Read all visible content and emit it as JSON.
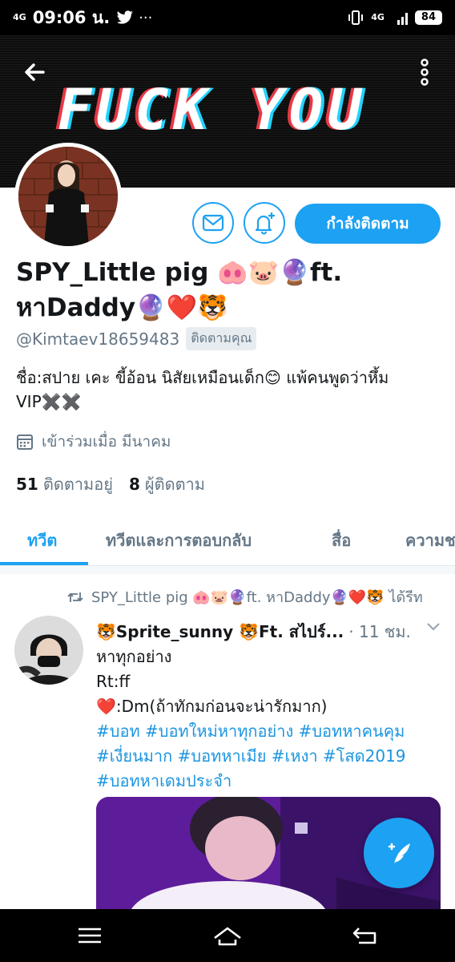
{
  "status_bar": {
    "network_left": "4G",
    "time": "09:06 น.",
    "network_right": "4G",
    "battery": "84",
    "icons": [
      "twitter-icon",
      "more-dots-icon",
      "vibrate-icon",
      "signal-icon",
      "battery-icon"
    ]
  },
  "banner": {
    "text": "FUCK YOU"
  },
  "profile": {
    "name_line1": "SPY_Little pig 🐽🐷🔮ft.",
    "name_line2": "หาDaddy🔮❤️🐯",
    "handle": "@Kimtaev18659483",
    "follows_you": "ติดตามคุณ",
    "bio": "ชื่อ:สปาย เคะ ขี้อ้อน นิสัยเหมือนเด็ก😊 แพ้คนพูดว่าหึ้ม VIP✖️✖️",
    "joined": "เข้าร่วมเมื่อ มีนาคม",
    "following_count": "51",
    "following_label": "ติดตามอยู่",
    "followers_count": "8",
    "followers_label": "ผู้ติดตาม",
    "follow_button": "กำลังติดตาม"
  },
  "tabs": [
    {
      "label": "ทวีต"
    },
    {
      "label": "ทวีตและการตอบกลับ"
    },
    {
      "label": "สื่อ"
    },
    {
      "label": "ความช"
    }
  ],
  "tweet": {
    "retweet_label": "SPY_Little pig 🐽🐷🔮ft. หาDaddy🔮❤️🐯 ได้รีท",
    "author": "🐯Sprite_sunny 🐯Ft. สไปร์...",
    "time": "· 11 ชม.",
    "lines": [
      "หาทุกอย่าง",
      "Rt:ff",
      "❤️:Dm(ถ้าทักมก่อนจะน่ารักมาก)"
    ],
    "tags_line1": "#บอท #บอทใหม่หาทุกอย่าง #บอทหาคนคุม",
    "tags_line2": "#เงี่ยนมาก #บอทหาเมีย #เหงา #โสด2019",
    "tags_line3": "#บอทหาเดมประจำ"
  },
  "colors": {
    "accent": "#1da1f2",
    "text": "#14171a",
    "muted": "#657786",
    "hashtag": "#1b95e0"
  }
}
